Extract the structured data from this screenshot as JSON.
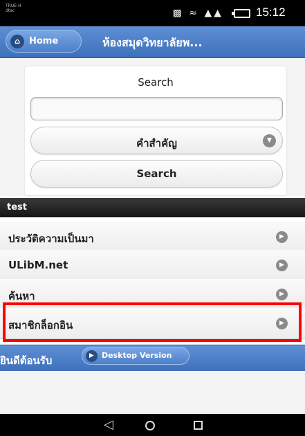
{
  "status_bar": {
    "carrier": "TRUE-H",
    "carrier_sub": "dtac",
    "signal_text": "4G 2G",
    "time": "15:12"
  },
  "header": {
    "home_label": "Home",
    "title": "ห้องสมุดวิทยาลัยพ..."
  },
  "search": {
    "heading": "Search",
    "input_value": "",
    "select_value": "คำสำคัญ",
    "submit_label": "Search"
  },
  "list": {
    "divider": "test",
    "items": [
      {
        "label": "ประวัติความเป็นมา"
      },
      {
        "label": "ULibM.net"
      },
      {
        "label": "ค้นหา"
      },
      {
        "label": "สมาชิกล็อกอิน"
      }
    ]
  },
  "footer": {
    "welcome": "ยินดีต้อนรับ",
    "desktop_label": "Desktop Version"
  },
  "colors": {
    "header_blue": "#4a7cc4",
    "highlight": "#ff0000"
  }
}
